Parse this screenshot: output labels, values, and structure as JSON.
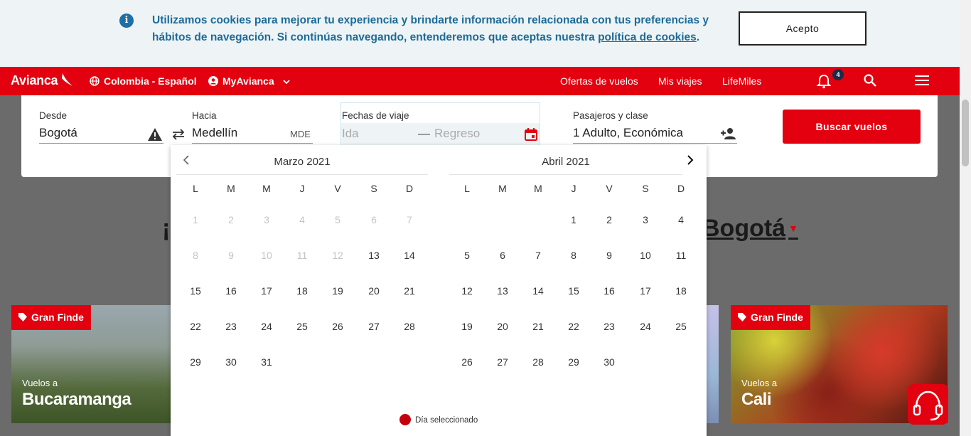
{
  "cookie": {
    "text": "Utilizamos cookies para mejorar tu experiencia y brindarte información relacionada con tus preferencias y hábitos de navegación. Si continúas navegando, entenderemos que aceptas nuestra",
    "link": "política de cookies",
    "after": ".",
    "accept_label": "Acepto",
    "info_icon": "i"
  },
  "nav": {
    "logo": "Avianca",
    "region": "Colombia - Español",
    "account": "MyAvianca",
    "links": [
      "Ofertas de vuelos",
      "Mis viajes",
      "LifeMiles"
    ],
    "notification_count": "4"
  },
  "form": {
    "from_label": "Desde",
    "from_value": "Bogotá",
    "to_label": "Hacia",
    "to_value": "Medellín",
    "to_code": "MDE",
    "dates_label": "Fechas de viaje",
    "depart_placeholder": "Ida",
    "return_placeholder": "Regreso",
    "dash": "—",
    "pax_label": "Pasajeros y clase",
    "pax_value": "1 Adulto, Económica",
    "submit_label": "Buscar vuelos"
  },
  "background": {
    "headline_left": "¡",
    "headline_right": "Bogotá",
    "cards": [
      {
        "tag": "Gran Finde",
        "sub": "Vuelos a",
        "city": "Bucaramanga"
      },
      {
        "tag": "Gran Finde",
        "sub": "Vuelos a",
        "city": "Cali"
      }
    ]
  },
  "calendar": {
    "weekdays": [
      "L",
      "M",
      "M",
      "J",
      "V",
      "S",
      "D"
    ],
    "months": [
      {
        "title": "Marzo 2021",
        "offset": 0,
        "days": 31,
        "disabled_until": 12
      },
      {
        "title": "Abril 2021",
        "offset": 3,
        "days": 30,
        "disabled_until": 0
      }
    ],
    "legend": "Día seleccionado"
  },
  "colors": {
    "brand_red": "#e3000f",
    "cookie_text": "#1d6b98"
  }
}
